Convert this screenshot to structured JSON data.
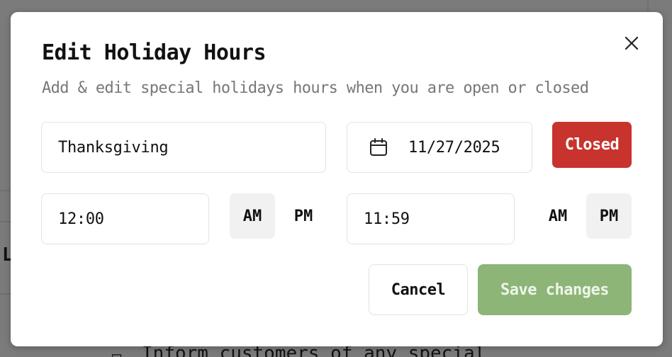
{
  "background": {
    "partial_text_left": "L",
    "partial_text_bottom": "Inform customers of any special"
  },
  "modal": {
    "title": "Edit Holiday Hours",
    "subtitle": "Add & edit special holidays hours when you are open or closed",
    "close_icon": "close-icon",
    "holiday_name": "Thanksgiving",
    "date": "11/27/2025",
    "calendar_icon": "calendar-icon",
    "closed_label": "Closed",
    "start_time": "12:00",
    "end_time": "11:59",
    "start_period": {
      "am": "AM",
      "pm": "PM",
      "selected": "AM"
    },
    "end_period": {
      "am": "AM",
      "pm": "PM",
      "selected": "PM"
    },
    "cancel_label": "Cancel",
    "save_label": "Save changes"
  },
  "colors": {
    "closed": "#c8332d",
    "save": "#8db577",
    "overlay": "#7b7b7b"
  }
}
